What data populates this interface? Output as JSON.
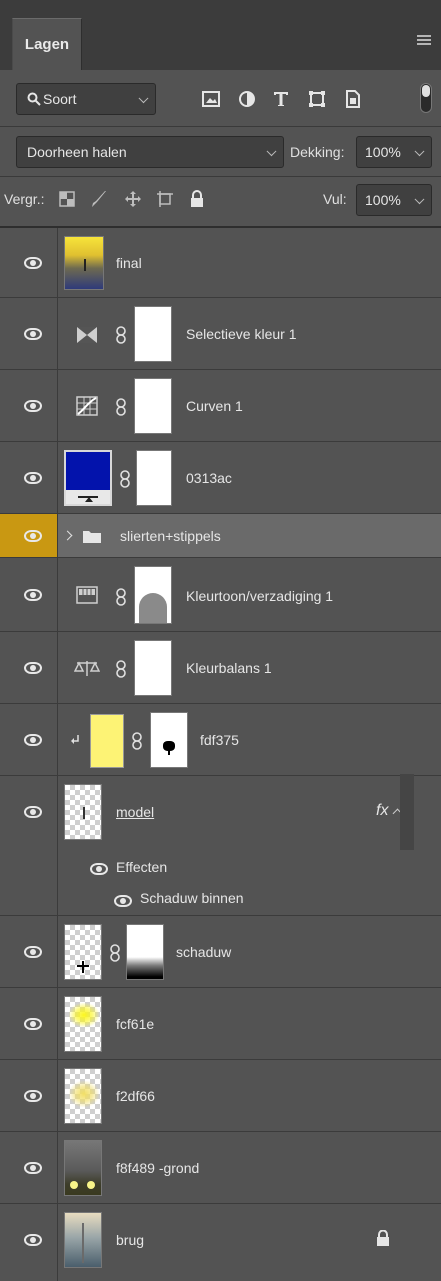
{
  "panel": {
    "tab_label": "Lagen"
  },
  "filter": {
    "kind_label": "Soort",
    "blend_mode": "Doorheen halen",
    "opacity_label": "Dekking:",
    "opacity_value": "100%",
    "lock_label": "Vergr.:",
    "fill_label": "Vul:",
    "fill_value": "100%"
  },
  "layers": [
    {
      "name": "final"
    },
    {
      "name": "Selectieve kleur 1"
    },
    {
      "name": "Curven 1"
    },
    {
      "name": "0313ac"
    },
    {
      "name": "slierten+stippels"
    },
    {
      "name": "Kleurtoon/verzadiging 1"
    },
    {
      "name": "Kleurbalans 1"
    },
    {
      "name": "fdf375"
    },
    {
      "name": "model",
      "fx": "fx",
      "effects_label": "Effecten",
      "effect_item": "Schaduw binnen"
    },
    {
      "name": "schaduw"
    },
    {
      "name": "fcf61e"
    },
    {
      "name": "f2df66"
    },
    {
      "name": "f8f489 -grond"
    },
    {
      "name": "brug"
    }
  ],
  "colors": {
    "panel_bg": "#535353",
    "selected_row": "#6a6a6a",
    "selected_eye": "#c99812",
    "fill_layer_yellow": "#fdf375",
    "solid_blue": "#0313ac"
  }
}
